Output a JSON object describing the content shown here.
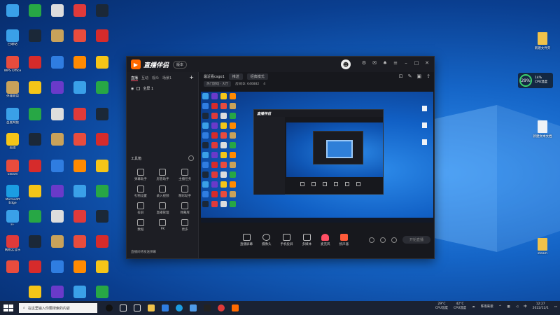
{
  "desktop": {
    "left_icons": [
      {
        "label": "回收站",
        "color": "#3aa0e8"
      },
      {
        "label": "英雄联盟",
        "color": "#c9a25a"
      },
      {
        "label": "美团",
        "color": "#f5c518"
      },
      {
        "label": "Microsoft Edge",
        "color": "#1b9de2"
      },
      {
        "label": "网易云音乐",
        "color": "#e03a3a"
      },
      {
        "label": "WPS Office",
        "color": "#e84c3d"
      },
      {
        "label": "百度网盘",
        "color": "#2f7de1"
      },
      {
        "label": "Steam",
        "color": "#1b2838"
      },
      {
        "label": "FF",
        "color": "#222a36"
      }
    ],
    "right_icons": [
      {
        "label": "新建文件夹",
        "type": "folder"
      },
      {
        "label": "新建文本文档",
        "type": "doc"
      },
      {
        "label": "steam",
        "type": "folder"
      }
    ],
    "widget": {
      "percent": "29%",
      "cpu_line1": "14%",
      "cpu_line2": "CPU温度"
    }
  },
  "app": {
    "name": "直播伴侣",
    "tag": "版本",
    "sidebar": {
      "tabs": [
        "直播",
        "互动",
        "观众",
        "场景1"
      ],
      "scene_item": "全屏 1",
      "tools_title": "工具箱",
      "tools": [
        "弹幕助手",
        "房管助手",
        "主播任务",
        "礼物设置",
        "录入视频",
        "精彩助手",
        "投屏",
        "直播管理",
        "弹幕库",
        "数据",
        "PK",
        "更多"
      ],
      "footer": "直播间待发送弹幕"
    },
    "room": {
      "title": "最近看csgo1",
      "chip1": "推送",
      "chip2": "经典模式",
      "info": [
        "热门游戏 · 大厅",
        "房间ID: 646882",
        "4"
      ]
    },
    "bottom_bar": [
      "直播屏幕",
      "摄像头",
      "手机投屏",
      "多媒体",
      "麦克风",
      "扬声器"
    ],
    "go_live": "开始直播"
  },
  "taskbar": {
    "search_placeholder": "在这里输入你要搜索的内容",
    "cpu_temp": "29°C",
    "cpu_label": "CPU温度",
    "cpu2": "42°C",
    "cpu2_label": "CPU温度",
    "weather": "阵雨来袭",
    "time": "12:27",
    "date": "2022/12/1"
  },
  "colors": {
    "accent": "#ff4f64",
    "brand": "#ff6a00"
  }
}
